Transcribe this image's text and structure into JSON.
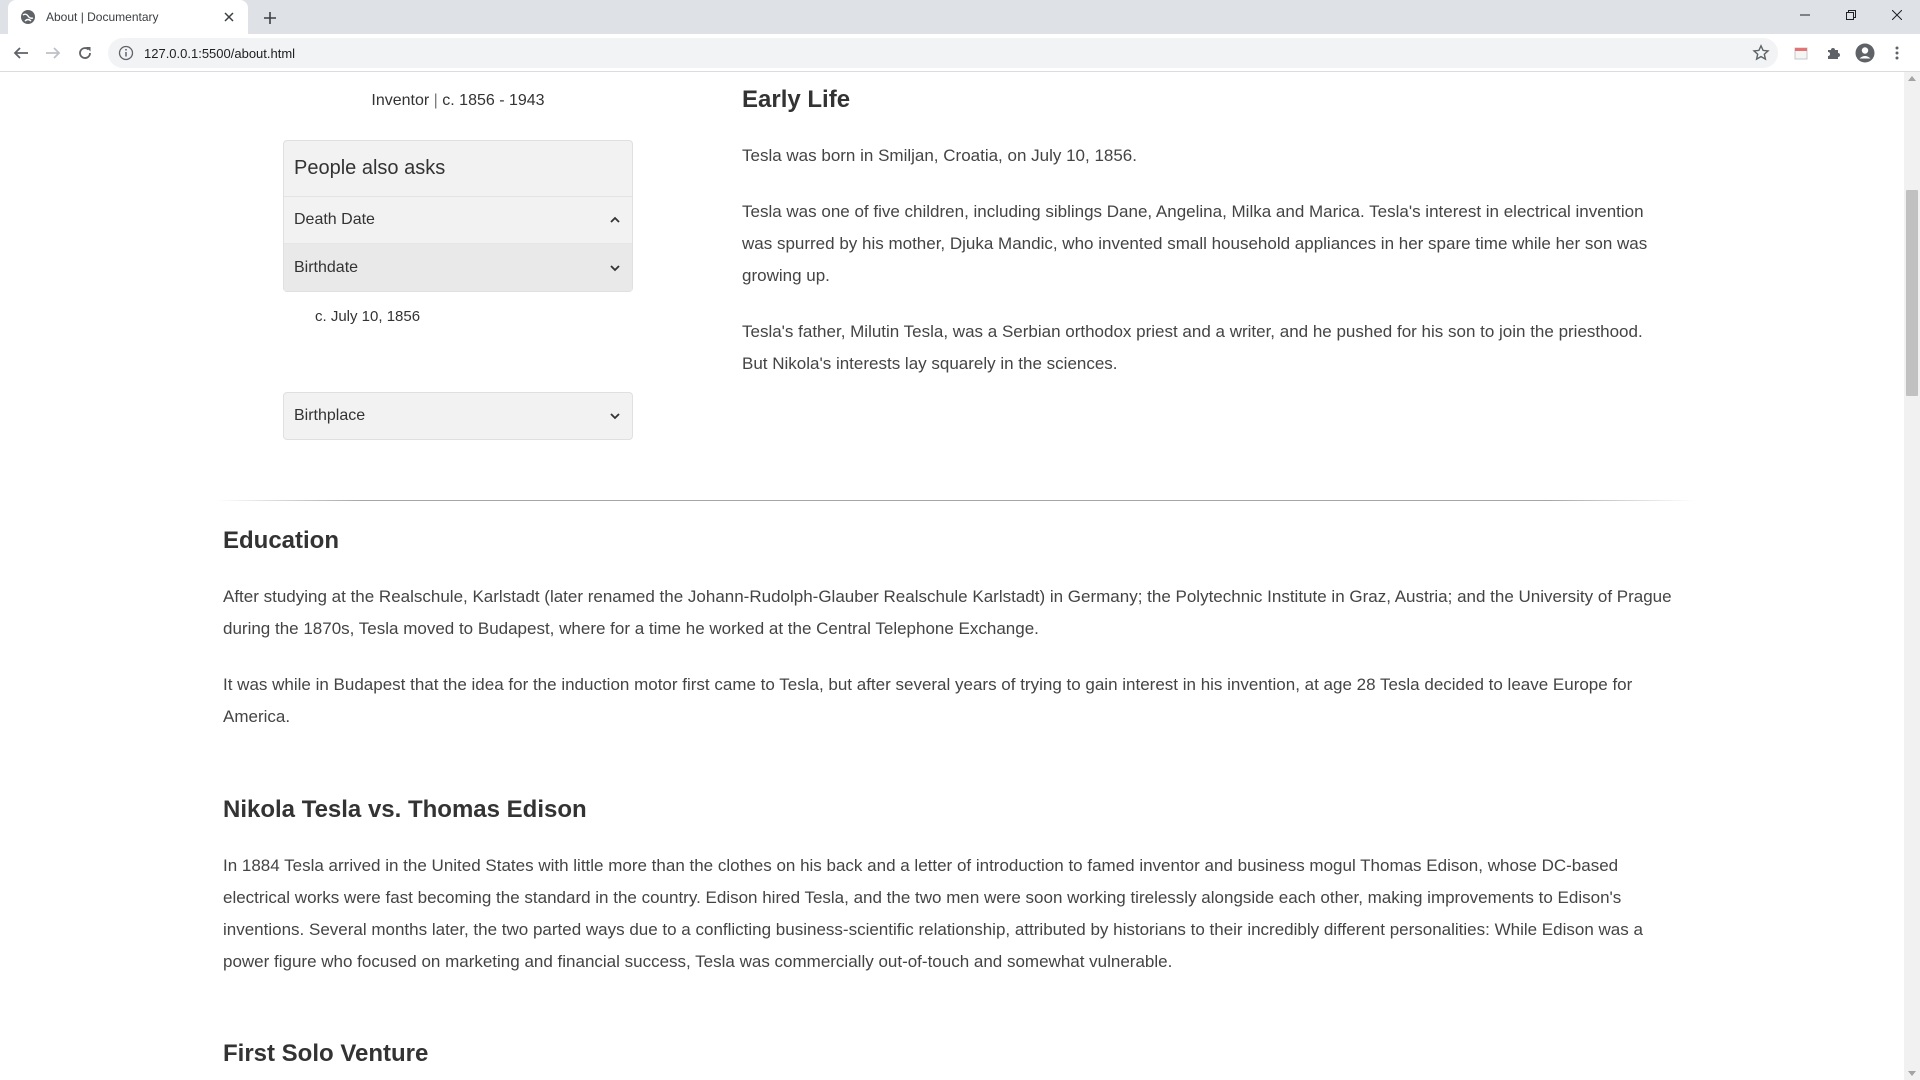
{
  "browser": {
    "tab_title": "About | Documentary",
    "url": "127.0.0.1:5500/about.html"
  },
  "sidebar": {
    "role": "Inventor",
    "separator": "|",
    "years": "c. 1856 - 1943",
    "accordion_title": "People also asks",
    "items": [
      {
        "label": "Death Date",
        "state": "expanded-chevron-up"
      },
      {
        "label": "Birthdate",
        "state": "active-chevron-down"
      }
    ],
    "birthdate_answer": "c. July 10, 1856",
    "birthplace_label": "Birthplace"
  },
  "early_life": {
    "title": "Early Life",
    "paragraphs": [
      "Tesla was born in Smiljan, Croatia, on July 10, 1856.",
      "Tesla was one of five children, including siblings Dane, Angelina, Milka and Marica. Tesla's interest in electrical invention was spurred by his mother, Djuka Mandic, who invented small household appliances in her spare time while her son was growing up.",
      "Tesla's father, Milutin Tesla, was a Serbian orthodox priest and a writer, and he pushed for his son to join the priesthood. But Nikola's interests lay squarely in the sciences."
    ]
  },
  "education": {
    "title": "Education",
    "paragraphs": [
      "After studying at the Realschule, Karlstadt (later renamed the Johann-Rudolph-Glauber Realschule Karlstadt) in Germany; the Polytechnic Institute in Graz, Austria; and the University of Prague during the 1870s, Tesla moved to Budapest, where for a time he worked at the Central Telephone Exchange.",
      "It was while in Budapest that the idea for the induction motor first came to Tesla, but after several years of trying to gain interest in his invention, at age 28 Tesla decided to leave Europe for America."
    ]
  },
  "versus": {
    "title": "Nikola Tesla vs. Thomas Edison",
    "paragraphs": [
      "In 1884 Tesla arrived in the United States with little more than the clothes on his back and a letter of introduction to famed inventor and business mogul Thomas Edison, whose DC-based electrical works were fast becoming the standard in the country. Edison hired Tesla, and the two men were soon working tirelessly alongside each other, making improvements to Edison's inventions. Several months later, the two parted ways due to a conflicting business-scientific relationship, attributed by historians to their incredibly different personalities: While Edison was a power figure who focused on marketing and financial success, Tesla was commercially out-of-touch and somewhat vulnerable."
    ]
  },
  "solo": {
    "title": "First Solo Venture"
  },
  "icons": {
    "favicon": "globe-icon",
    "close": "close-icon",
    "new_tab": "plus-icon",
    "back": "back-arrow-icon",
    "forward": "forward-arrow-icon",
    "reload": "reload-icon",
    "info": "info-icon",
    "star": "star-icon",
    "extension": "puzzle-icon",
    "profile": "profile-icon",
    "menu": "kebab-menu-icon"
  }
}
